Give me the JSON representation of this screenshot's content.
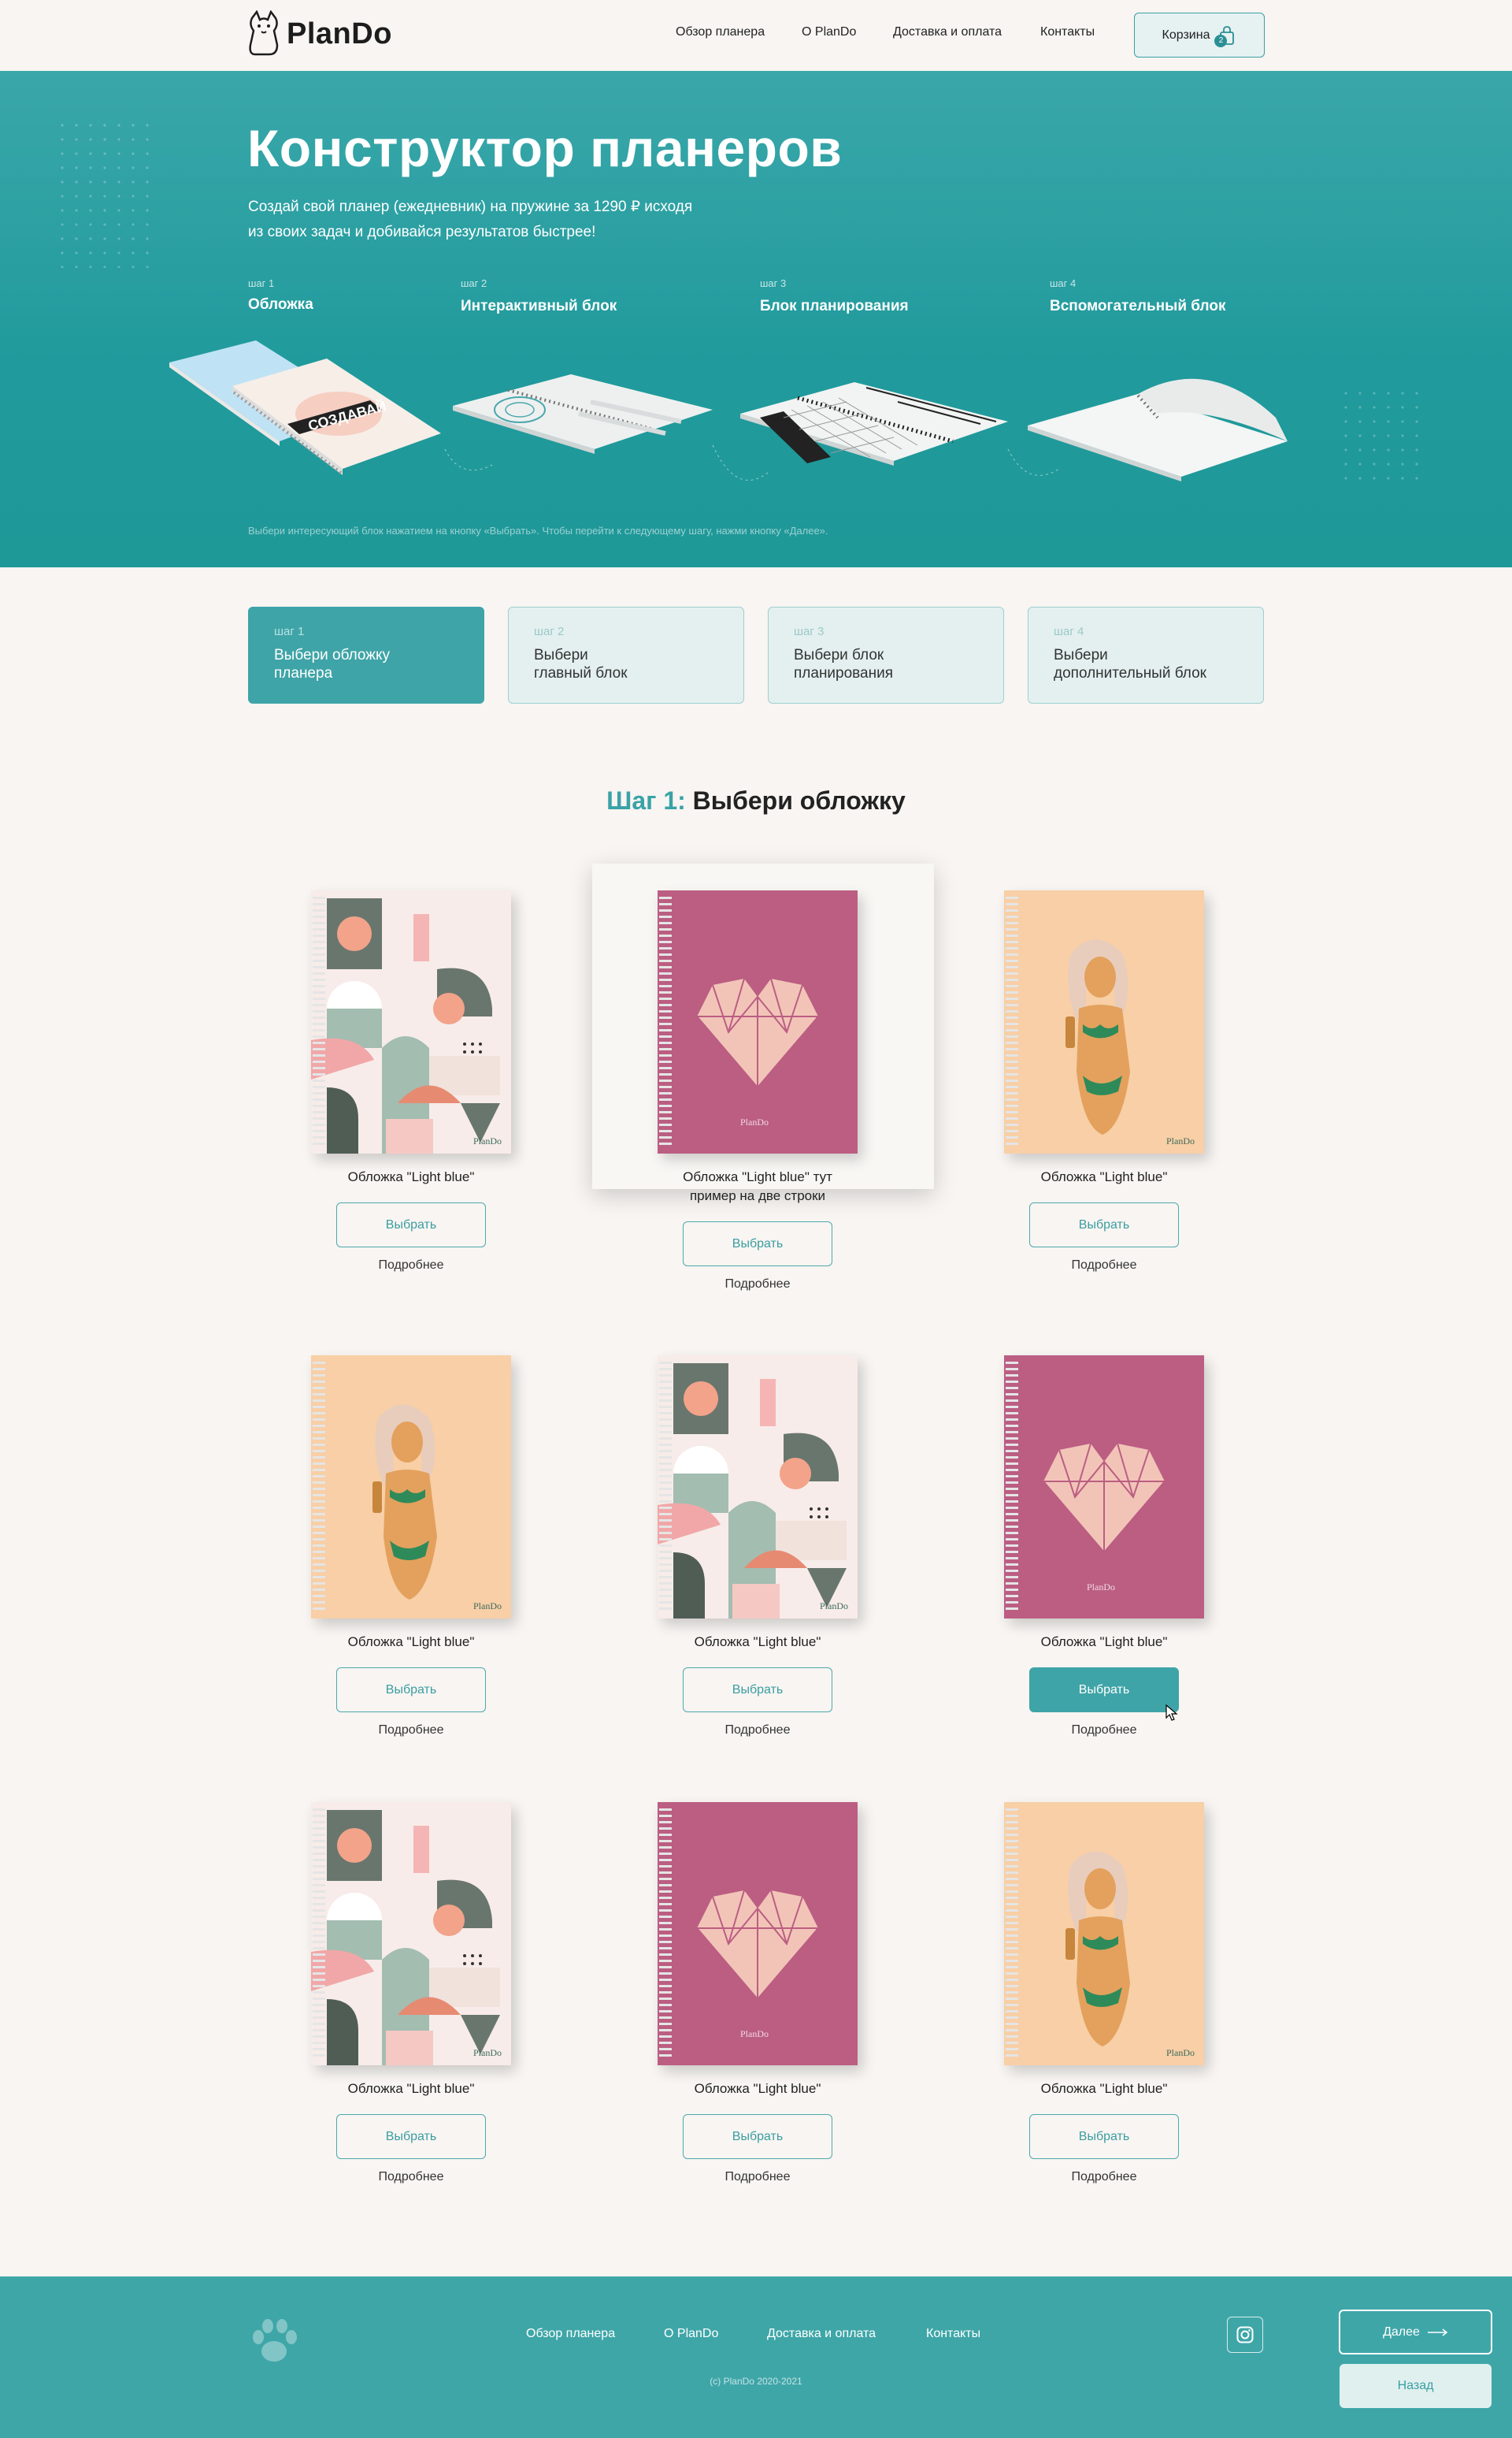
{
  "header": {
    "logo": "PlanDo",
    "nav": [
      "Обзор планера",
      "О PlanDo",
      "Доставка и оплата",
      "Контакты"
    ],
    "cart_label": "Корзина",
    "cart_count": "2"
  },
  "hero": {
    "title": "Конструктор планеров",
    "subtitle_line1": "Создай свой планер (ежедневник) на пружине за 1290 ₽ исходя",
    "subtitle_line2": "из своих задач и добивайся результатов быстрее!",
    "steps": [
      {
        "num": "шаг 1",
        "name": "Обложка"
      },
      {
        "num": "шаг 2",
        "name": "Интерактивный блок"
      },
      {
        "num": "шаг 3",
        "name": "Блок планирования"
      },
      {
        "num": "шаг 4",
        "name": "Вспомогательный блок"
      }
    ],
    "cover_print": "СОЗДАВАЙ",
    "hint": "Выбери интересующий блок нажатием на кнопку «Выбрать». Чтобы перейти к следующему шагу, нажми кнопку «Далее»."
  },
  "step_tabs": [
    {
      "num": "шаг 1",
      "line1": "Выбери обложку",
      "line2": "планера"
    },
    {
      "num": "шаг 2",
      "line1": "Выбери",
      "line2": "главный блок"
    },
    {
      "num": "шаг 3",
      "line1": "Выбери блок",
      "line2": "планирования"
    },
    {
      "num": "шаг 4",
      "line1": "Выбери",
      "line2": "дополнительный блок"
    }
  ],
  "section": {
    "accent": "Шаг 1:",
    "title": "Выбери обложку"
  },
  "products": {
    "select_label": "Выбрать",
    "more_label": "Подробнее",
    "brand": "PlanDo",
    "items": [
      {
        "cover": "geometric",
        "caption": "Обложка \"Light blue\""
      },
      {
        "cover": "heart",
        "caption": "Обложка \"Light blue\" тут пример на две строки"
      },
      {
        "cover": "girl",
        "caption": "Обложка \"Light blue\""
      },
      {
        "cover": "girl",
        "caption": "Обложка \"Light blue\""
      },
      {
        "cover": "geometric",
        "caption": "Обложка \"Light blue\""
      },
      {
        "cover": "heart",
        "caption": "Обложка \"Light blue\""
      },
      {
        "cover": "geometric",
        "caption": "Обложка \"Light blue\""
      },
      {
        "cover": "heart",
        "caption": "Обложка \"Light blue\""
      },
      {
        "cover": "girl",
        "caption": "Обложка \"Light blue\""
      }
    ]
  },
  "footer": {
    "nav": [
      "Обзор планера",
      "О PlanDo",
      "Доставка и оплата",
      "Контакты"
    ],
    "copyright": "(c) PlanDo 2020-2021",
    "next_label": "Далее",
    "back_label": "Назад"
  },
  "colors": {
    "accent": "#3fa4a7",
    "hero": "#209a9c",
    "footer": "#3fa6a8",
    "bg": "#f8f5f2"
  }
}
